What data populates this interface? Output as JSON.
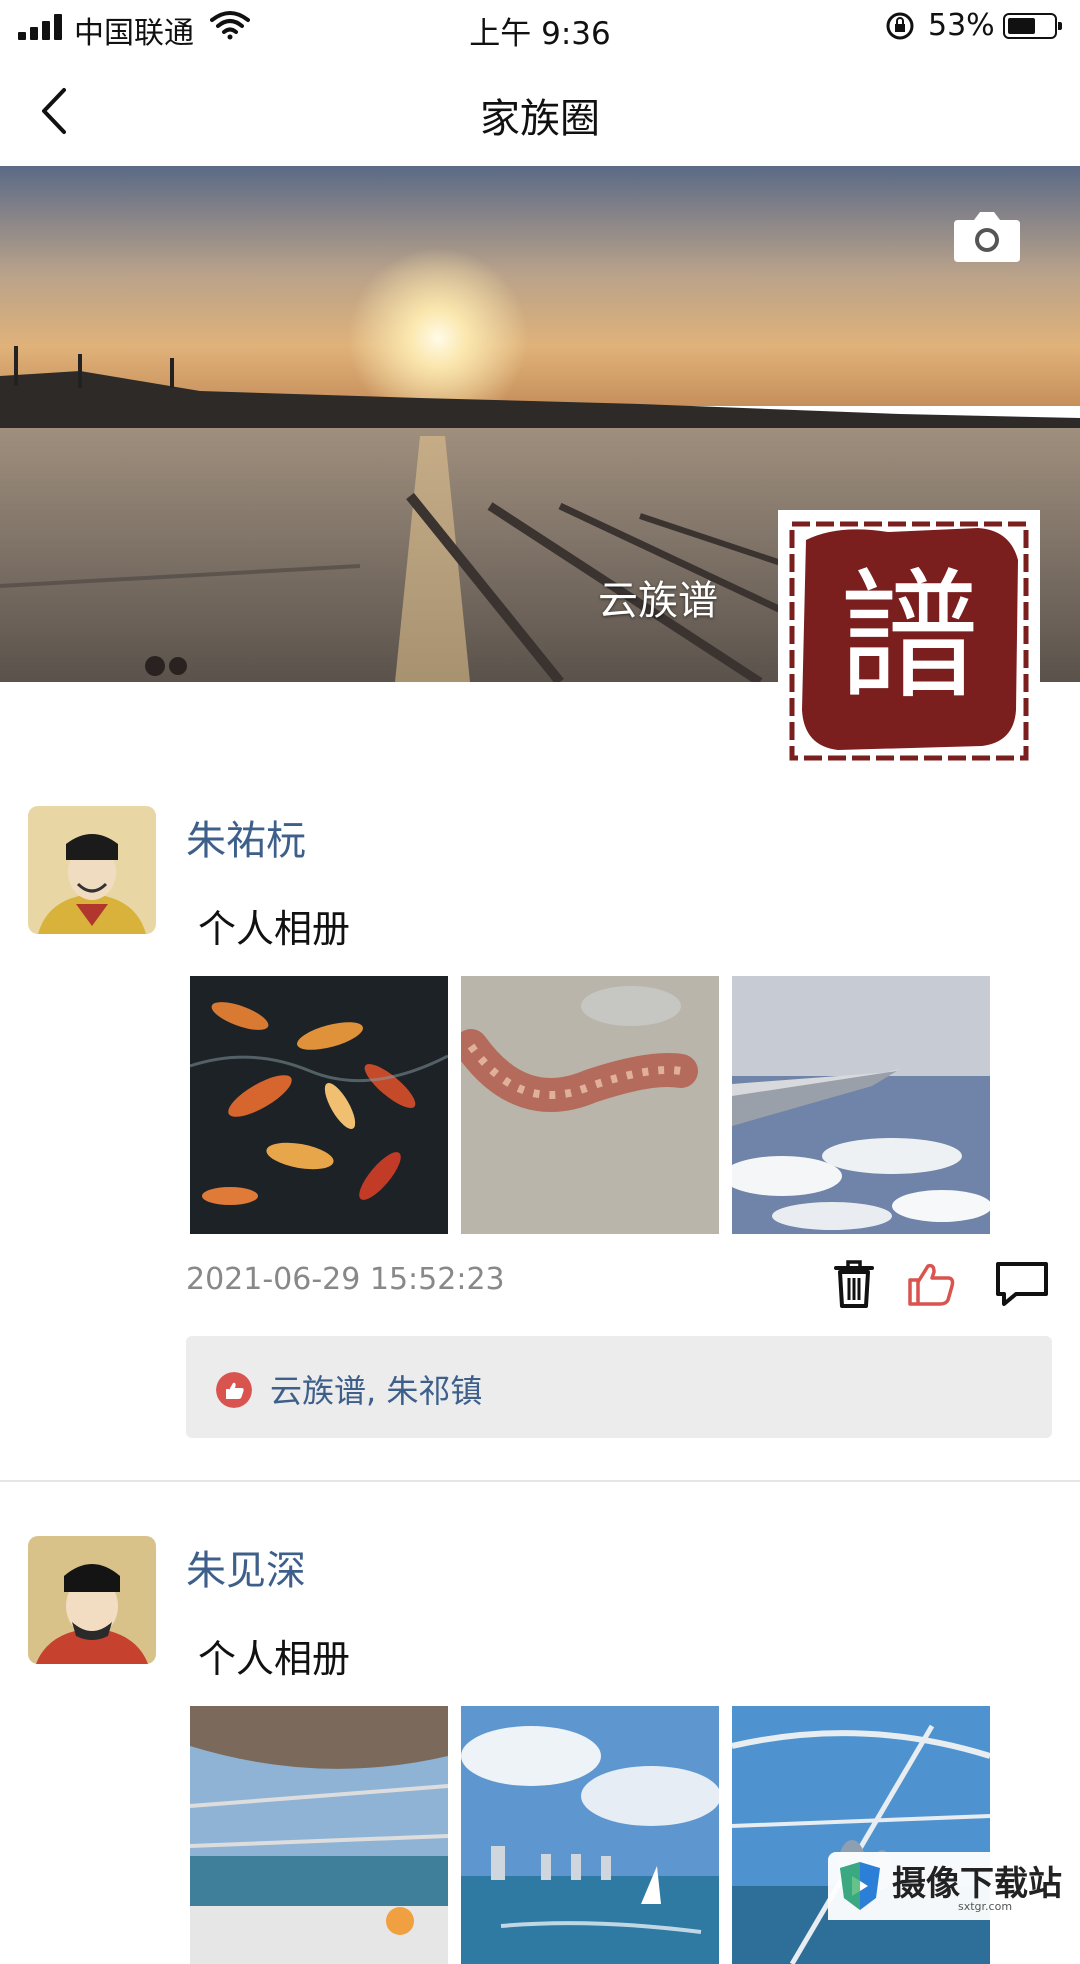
{
  "status_bar": {
    "carrier": "中国联通",
    "time": "上午 9:36",
    "battery": "53%"
  },
  "nav": {
    "title": "家族圈"
  },
  "cover": {
    "name": "云族谱"
  },
  "posts": [
    {
      "user": "朱祐杬",
      "text": "个人相册",
      "time": "2021-06-29 15:52:23",
      "likes": "云族谱, 朱祁镇"
    },
    {
      "user": "朱见深",
      "text": "个人相册"
    }
  ],
  "watermark": {
    "text": "摄像下载站",
    "url": "sxtgr.com"
  },
  "colors": {
    "username": "#3d5f8a",
    "like_red": "#d9534f",
    "seal_red": "#7a1e1e"
  }
}
